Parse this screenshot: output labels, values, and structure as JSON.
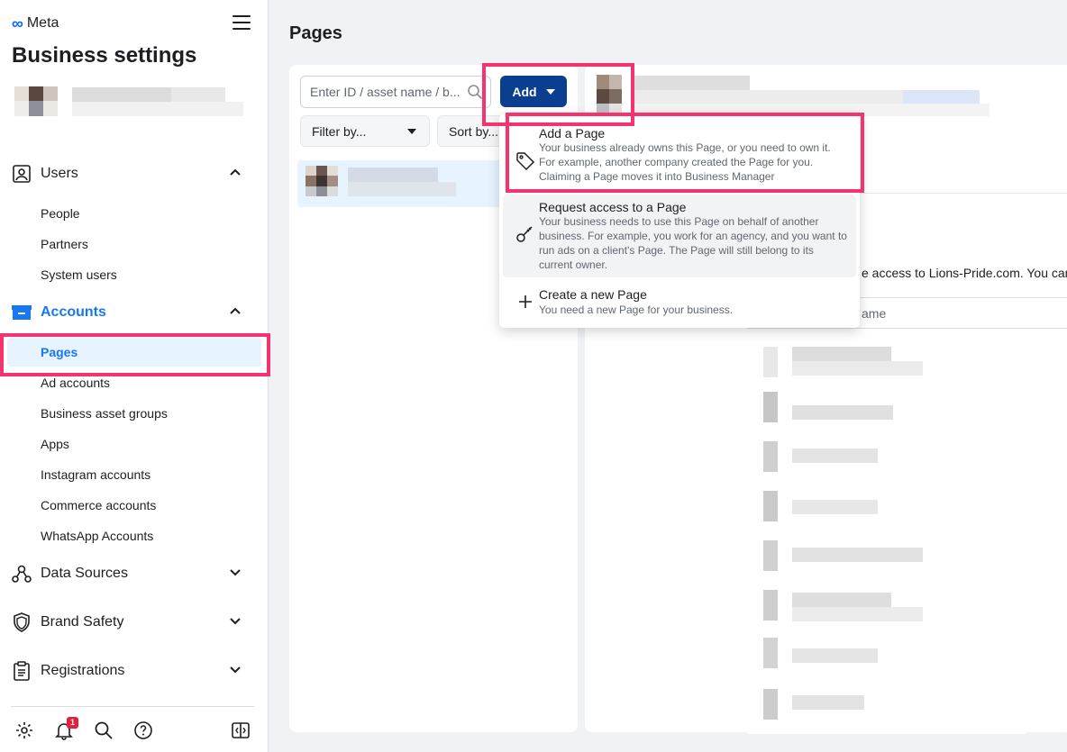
{
  "app": {
    "brand": "Meta",
    "title": "Business settings"
  },
  "sidebar": {
    "sections": [
      {
        "label": "Users",
        "icon": "users-icon",
        "expanded": true,
        "items": [
          "People",
          "Partners",
          "System users"
        ]
      },
      {
        "label": "Accounts",
        "icon": "accounts-icon",
        "expanded": true,
        "active": true,
        "items": [
          "Pages",
          "Ad accounts",
          "Business asset groups",
          "Apps",
          "Instagram accounts",
          "Commerce accounts",
          "WhatsApp Accounts"
        ]
      },
      {
        "label": "Data Sources",
        "icon": "data-sources-icon",
        "expanded": false
      },
      {
        "label": "Brand Safety",
        "icon": "shield-icon",
        "expanded": false
      },
      {
        "label": "Registrations",
        "icon": "clipboard-icon",
        "expanded": false
      }
    ],
    "active_item": "Pages",
    "notification_count": "1"
  },
  "main": {
    "heading": "Pages",
    "search_placeholder": "Enter ID / asset name / b...",
    "add_label": "Add",
    "filter_label": "Filter by...",
    "sort_label": "Sort by...",
    "detail_text": "e access to Lions-Pride.com. You can",
    "table_header": "ame"
  },
  "dropdown": {
    "items": [
      {
        "title": "Add a Page",
        "icon": "tag-icon",
        "description": "Your business already owns this Page, or you need to own it. For example, another company created the Page for you. Claiming a Page moves it into Business Manager"
      },
      {
        "title": "Request access to a Page",
        "icon": "key-icon",
        "description": "Your business needs to use this Page on behalf of another business. For example, you work for an agency, and you want to run ads on a client's Page. The Page will still belong to its current owner."
      },
      {
        "title": "Create a new Page",
        "icon": "plus-icon",
        "description": "You need a new Page for your business."
      }
    ]
  },
  "colors": {
    "accent": "#1877f2",
    "add_button": "#0a3e91",
    "highlight": "#f5336f"
  }
}
